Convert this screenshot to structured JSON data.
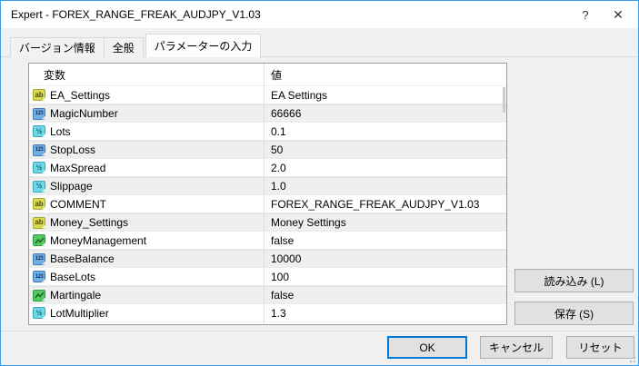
{
  "window": {
    "title": "Expert - FOREX_RANGE_FREAK_AUDJPY_V1.03",
    "help_glyph": "?",
    "close_glyph": "✕"
  },
  "tabs": [
    {
      "label": "バージョン情報",
      "active": false
    },
    {
      "label": "全般",
      "active": false
    },
    {
      "label": "パラメーターの入力",
      "active": true
    }
  ],
  "param_table": {
    "headers": {
      "variable": "変数",
      "value": "値"
    },
    "icon_glyphs": {
      "string": "ab",
      "int": "123",
      "double": "½",
      "bool": "∿"
    },
    "rows": [
      {
        "icon": "string",
        "variable": "EA_Settings",
        "value": "EA Settings"
      },
      {
        "icon": "int",
        "variable": "MagicNumber",
        "value": "66666"
      },
      {
        "icon": "double",
        "variable": "Lots",
        "value": "0.1"
      },
      {
        "icon": "int",
        "variable": "StopLoss",
        "value": "50"
      },
      {
        "icon": "double",
        "variable": "MaxSpread",
        "value": "2.0"
      },
      {
        "icon": "double",
        "variable": "Slippage",
        "value": "1.0"
      },
      {
        "icon": "string",
        "variable": "COMMENT",
        "value": "FOREX_RANGE_FREAK_AUDJPY_V1.03"
      },
      {
        "icon": "string",
        "variable": "Money_Settings",
        "value": "Money Settings"
      },
      {
        "icon": "bool",
        "variable": "MoneyManagement",
        "value": "false"
      },
      {
        "icon": "int",
        "variable": "BaseBalance",
        "value": "10000"
      },
      {
        "icon": "int",
        "variable": "BaseLots",
        "value": "100"
      },
      {
        "icon": "bool",
        "variable": "Martingale",
        "value": "false"
      },
      {
        "icon": "double",
        "variable": "LotMultiplier",
        "value": "1.3"
      }
    ]
  },
  "buttons": {
    "load": "読み込み (L)",
    "save": "保存 (S)",
    "ok": "OK",
    "cancel": "キャンセル",
    "reset": "リセット"
  },
  "colors": {
    "window_border": "#3d9be9",
    "focus_accent": "#0078d7",
    "row_alt": "#efefef",
    "icon_string": "#d9d957",
    "icon_int": "#72aee0",
    "icon_double": "#6fd8e8",
    "icon_bool": "#55c861"
  }
}
